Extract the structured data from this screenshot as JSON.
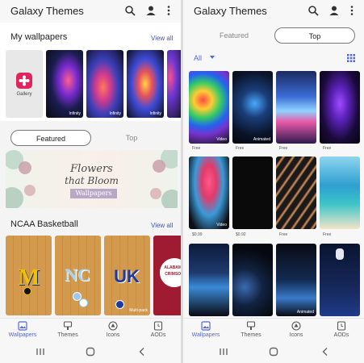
{
  "left": {
    "app_title": "Galaxy Themes",
    "my_wallpapers": {
      "title": "My wallpapers",
      "view_all": "View all",
      "items": [
        {
          "label": "Gallery"
        },
        {
          "label": "Infinity"
        },
        {
          "label": "Infinity"
        },
        {
          "label": "Infinity"
        }
      ]
    },
    "tabs": {
      "featured": "Featured",
      "top": "Top"
    },
    "banner": {
      "line1": "Flowers",
      "line2": "that Bloom",
      "line3": "Wallpapers"
    },
    "ncaa": {
      "title": "NCAA Basketball",
      "view_all": "View all",
      "items": [
        {
          "logo": "M",
          "badge": ""
        },
        {
          "logo": "NC",
          "badge": ""
        },
        {
          "logo": "UK",
          "badge": "Multi-pack"
        },
        {
          "logo": "ALABAMA CRIMSON",
          "badge": ""
        }
      ]
    }
  },
  "right": {
    "app_title": "Galaxy Themes",
    "tabs": {
      "featured": "Featured",
      "top": "Top"
    },
    "filter": "All",
    "grid": [
      {
        "badge": "Video",
        "price": "Free"
      },
      {
        "badge": "Animated",
        "price": "Free"
      },
      {
        "badge": "",
        "price": "Free"
      },
      {
        "badge": "",
        "price": "Free"
      },
      {
        "badge": "Video",
        "price": "$0.99"
      },
      {
        "badge": "",
        "price": "$0.92"
      },
      {
        "badge": "",
        "price": "Free"
      },
      {
        "badge": "",
        "price": "Free"
      },
      {
        "badge": "",
        "price": ""
      },
      {
        "badge": "",
        "price": ""
      },
      {
        "badge": "Animated",
        "price": ""
      },
      {
        "badge": "",
        "price": ""
      }
    ]
  },
  "nav": {
    "wallpapers": "Wallpapers",
    "themes": "Themes",
    "icons": "Icons",
    "aods": "AODs"
  },
  "colors": {
    "accent": "#5568d4",
    "link": "#3a57c8",
    "gallery_icon": "#e0245e"
  }
}
